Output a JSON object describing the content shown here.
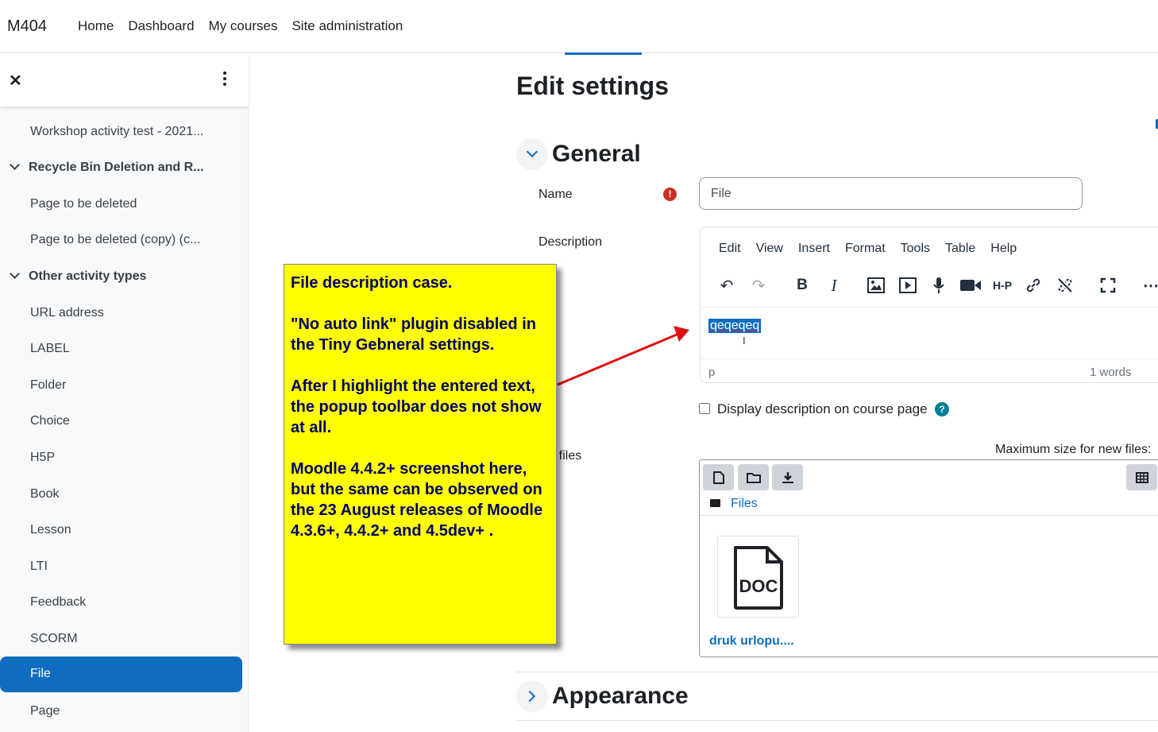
{
  "navbar": {
    "brand": "M404",
    "links": [
      "Home",
      "Dashboard",
      "My courses",
      "Site administration"
    ]
  },
  "sidebar": {
    "items": [
      {
        "type": "item",
        "label": "Workshop activity test - 2021..."
      },
      {
        "type": "section",
        "label": "Recycle Bin Deletion and R..."
      },
      {
        "type": "item",
        "label": "Page to be deleted"
      },
      {
        "type": "item",
        "label": "Page to be deleted (copy) (c..."
      },
      {
        "type": "section",
        "label": "Other activity types"
      },
      {
        "type": "item",
        "label": "URL address"
      },
      {
        "type": "item",
        "label": "LABEL"
      },
      {
        "type": "item",
        "label": "Folder"
      },
      {
        "type": "item",
        "label": "Choice"
      },
      {
        "type": "item",
        "label": "H5P"
      },
      {
        "type": "item",
        "label": "Book"
      },
      {
        "type": "item",
        "label": "Lesson"
      },
      {
        "type": "item",
        "label": "LTI"
      },
      {
        "type": "item",
        "label": "Feedback"
      },
      {
        "type": "item",
        "label": "SCORM"
      },
      {
        "type": "item",
        "label": "File"
      },
      {
        "type": "item",
        "label": "Page"
      }
    ],
    "active": "File"
  },
  "main": {
    "title": "Edit settings",
    "general": "General",
    "name_label": "Name",
    "name_value": "File",
    "description_label": "Description",
    "editor": {
      "menus": [
        "Edit",
        "View",
        "Insert",
        "Format",
        "Tools",
        "Table",
        "Help"
      ],
      "h5p_label": "H-P",
      "content": "qeqeqeq",
      "path": "p",
      "words": "1 words"
    },
    "display_description": "Display description on course page",
    "select_files_label": "ect files",
    "max_size_label": "Maximum size for new files:",
    "files_path": "Files",
    "file_type": "DOC",
    "file_name": "druk urlopu....",
    "appearance": "Appearance"
  },
  "annotation": {
    "paragraphs": [
      "File description case.",
      "\"No auto link\" plugin disabled in the Tiny Gebneral settings.",
      "After I highlight the entered text, the popup toolbar does not show at all.",
      "Moodle 4.4.2+ screenshot here, but the same can be observed on the 23 August releases of Moodle 4.3.6+, 4.4.2+ and 4.5dev+ ."
    ]
  },
  "colors": {
    "primary": "#0f6cbf",
    "required": "#ca3120",
    "help": "#008196",
    "sticky": "#ffff00",
    "arrow": "#e01010"
  }
}
